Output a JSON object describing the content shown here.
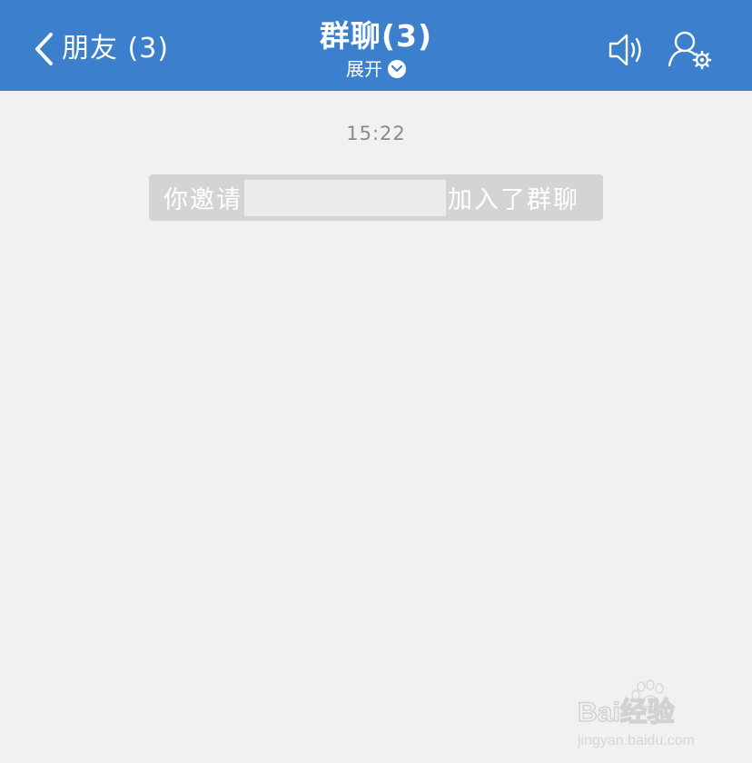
{
  "header": {
    "back_label": "朋友 (3)",
    "title": "群聊(3)",
    "expand_label": "展开"
  },
  "chat": {
    "time": "15:22",
    "notice_prefix": "你邀请",
    "notice_suffix": "加入了群聊"
  },
  "watermark": {
    "logo": "Bai经验",
    "url": "jingyan.baidu.com"
  },
  "colors": {
    "header_bg": "#3b7fcd",
    "page_bg": "#f1f1f2",
    "notice_bg": "#d4d4d5",
    "time_text": "#8a8a8a"
  },
  "icons": {
    "back": "chevron-left-icon",
    "expand": "chevron-down-circle-icon",
    "speaker": "speaker-icon",
    "group_settings": "person-gear-icon"
  }
}
